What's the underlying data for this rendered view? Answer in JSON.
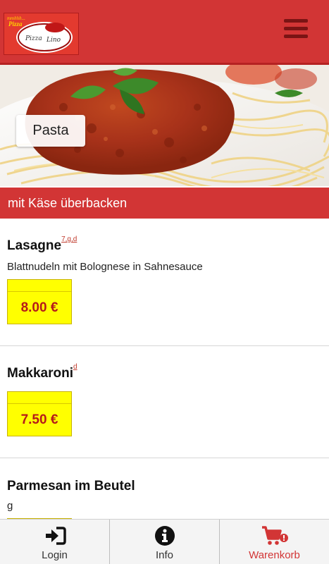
{
  "header": {
    "logo_tagline": "mmhhh...",
    "logo_word": "Pizza",
    "logo_script": "Pizza Lino",
    "menu_icon": "hamburger-menu-icon"
  },
  "hero": {
    "category_label": "Pasta"
  },
  "section": {
    "title": "mit Käse überbacken"
  },
  "items": [
    {
      "name": "Lasagne",
      "allergens": "7,g,d",
      "description": "Blattnudeln mit Bolognese in Sahnesauce",
      "price": "8.00 €"
    },
    {
      "name": "Makkaroni",
      "allergens": "d",
      "description": "",
      "price": "7.50 €"
    },
    {
      "name": "Parmesan im Beutel",
      "allergens": "",
      "description": "g",
      "price": ""
    }
  ],
  "bottom_nav": [
    {
      "label": "Login",
      "icon": "login-icon",
      "active": false
    },
    {
      "label": "Info",
      "icon": "info-icon",
      "active": false
    },
    {
      "label": "Warenkorb",
      "icon": "cart-icon",
      "active": true
    }
  ],
  "colors": {
    "brand_red": "#d23535",
    "price_yellow": "#ffff00",
    "price_text": "#b51a1a"
  }
}
